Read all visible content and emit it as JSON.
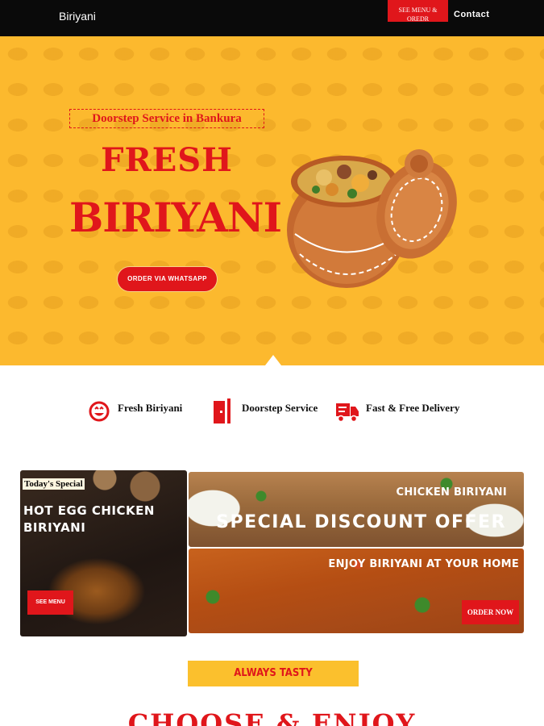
{
  "nav": {
    "brand": "Biriyani",
    "menu_button": "SEE MENU & OREDR",
    "contact": "Contact"
  },
  "hero": {
    "tagline": "Doorstep Service in Bankura",
    "title_line1": "FRESH",
    "title_line2": "BIRIYANI",
    "cta": "ORDER VIA WHATSAPP"
  },
  "features": [
    {
      "label": "Fresh Biriyani",
      "icon": "smiley-icon"
    },
    {
      "label": "Doorstep Service",
      "icon": "door-icon"
    },
    {
      "label": "Fast & Free Delivery",
      "icon": "truck-icon"
    }
  ],
  "promo": {
    "left": {
      "tag": "Today's Special",
      "title": "HOT EGG CHICKEN BIRIYANI",
      "button": "SEE MENU"
    },
    "top": {
      "subtitle": "CHICKEN BIRIYANI",
      "title": "SPECIAL DISCOUNT OFFER"
    },
    "bottom": {
      "title": "ENJOY BIRIYANI AT YOUR HOME",
      "button": "ORDER NOW"
    }
  },
  "section": {
    "badge": "ALWAYS TASTY",
    "heading": "CHOOSE & ENJOY"
  },
  "colors": {
    "accent": "#e0161b",
    "hero_bg": "#fcb92e",
    "nav_bg": "#0a0a0a"
  }
}
